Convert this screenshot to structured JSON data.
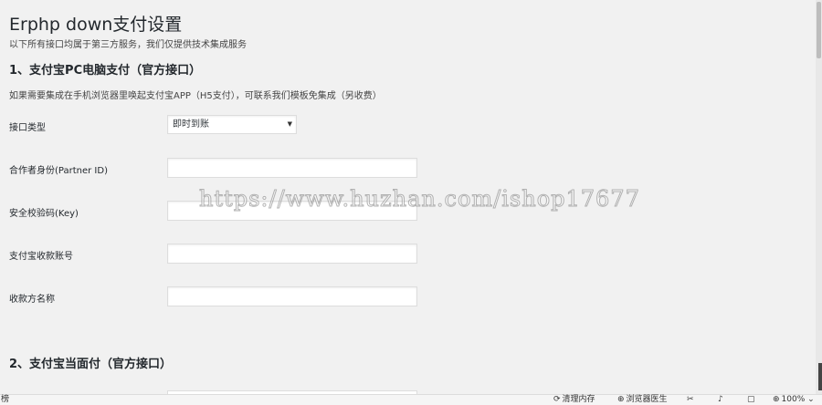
{
  "header": {
    "title": "Erphp down支付设置",
    "subtitle": "以下所有接口均属于第三方服务，我们仅提供技术集成服务"
  },
  "section1": {
    "title": "1、支付宝PC电脑支付（官方接口）",
    "description": "如果需要集成在手机浏览器里唤起支付宝APP（H5支付），可联系我们模板免集成（另收费）",
    "fields": [
      {
        "label": "接口类型",
        "type": "select",
        "value": "即时到账"
      },
      {
        "label": "合作者身份(Partner ID)",
        "type": "text",
        "value": ""
      },
      {
        "label": "安全校验码(Key)",
        "type": "text",
        "value": ""
      },
      {
        "label": "支付宝收款账号",
        "type": "text",
        "value": ""
      },
      {
        "label": "收款方名称",
        "type": "text",
        "value": ""
      }
    ]
  },
  "section2": {
    "title": "2、支付宝当面付（官方接口）"
  },
  "watermark": "https://www.huzhan.com/ishop17677",
  "statusbar": {
    "left_text": "榜",
    "clean_memory": "清理内存",
    "browser_doctor": "浏览器医生",
    "zoom": "100%"
  },
  "icons": {
    "clean": "refresh-icon",
    "doctor": "doctor-icon",
    "screenshot": "screenshot-icon",
    "sound": "speaker-icon",
    "window": "window-icon",
    "zoom": "zoom-icon"
  }
}
